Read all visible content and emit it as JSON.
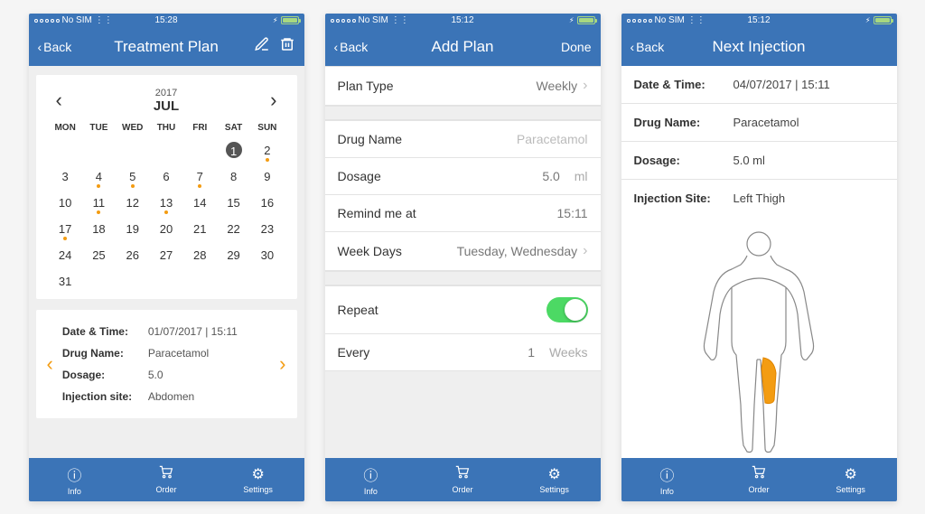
{
  "status_bar": {
    "carrier": "No SIM",
    "wifi_icon": "wifi-icon"
  },
  "tabs": {
    "info": "Info",
    "order": "Order",
    "settings": "Settings"
  },
  "nav": {
    "back": "Back",
    "done": "Done"
  },
  "colors": {
    "primary": "#3b74b7",
    "accent": "#f39c12",
    "toggle_on": "#4cd964"
  },
  "screen1": {
    "status_time": "15:28",
    "title": "Treatment Plan",
    "calendar": {
      "year": "2017",
      "month": "JUL",
      "weekdays": [
        "MON",
        "TUE",
        "WED",
        "THU",
        "FRI",
        "SAT",
        "SUN"
      ],
      "weeks": [
        [
          null,
          null,
          null,
          null,
          null,
          {
            "d": "1",
            "circled": true
          },
          {
            "d": "2",
            "marked": true
          }
        ],
        [
          {
            "d": "3"
          },
          {
            "d": "4",
            "marked": true
          },
          {
            "d": "5",
            "marked": true
          },
          {
            "d": "6"
          },
          {
            "d": "7",
            "marked": true
          },
          {
            "d": "8"
          },
          {
            "d": "9"
          }
        ],
        [
          {
            "d": "10"
          },
          {
            "d": "11",
            "marked": true
          },
          {
            "d": "12"
          },
          {
            "d": "13",
            "marked": true
          },
          {
            "d": "14"
          },
          {
            "d": "15"
          },
          {
            "d": "16"
          }
        ],
        [
          {
            "d": "17",
            "marked": true
          },
          {
            "d": "18"
          },
          {
            "d": "19"
          },
          {
            "d": "20"
          },
          {
            "d": "21"
          },
          {
            "d": "22"
          },
          {
            "d": "23"
          }
        ],
        [
          {
            "d": "24"
          },
          {
            "d": "25"
          },
          {
            "d": "26"
          },
          {
            "d": "27"
          },
          {
            "d": "28"
          },
          {
            "d": "29"
          },
          {
            "d": "30"
          }
        ],
        [
          {
            "d": "31"
          },
          null,
          null,
          null,
          null,
          null,
          null
        ]
      ]
    },
    "details": {
      "date_time_label": "Date & Time:",
      "date_time_value": "01/07/2017 | 15:11",
      "drug_label": "Drug Name:",
      "drug_value": "Paracetamol",
      "dosage_label": "Dosage:",
      "dosage_value": "5.0",
      "site_label": "Injection site:",
      "site_value": "Abdomen"
    }
  },
  "screen2": {
    "status_time": "15:12",
    "title": "Add Plan",
    "rows": {
      "plan_type_label": "Plan Type",
      "plan_type_value": "Weekly",
      "drug_label": "Drug Name",
      "drug_value": "Paracetamol",
      "dosage_label": "Dosage",
      "dosage_value": "5.0",
      "dosage_unit": "ml",
      "remind_label": "Remind me at",
      "remind_value": "15:11",
      "weekdays_label": "Week Days",
      "weekdays_value": "Tuesday, Wednesday",
      "repeat_label": "Repeat",
      "repeat_on": true,
      "every_label": "Every",
      "every_value": "1",
      "every_unit": "Weeks"
    }
  },
  "screen3": {
    "status_time": "15:12",
    "title": "Next Injection",
    "rows": {
      "date_time_label": "Date & Time:",
      "date_time_value": "04/07/2017 | 15:11",
      "drug_label": "Drug Name:",
      "drug_value": "Paracetamol",
      "dosage_label": "Dosage:",
      "dosage_value": "5.0 ml",
      "site_label": "Injection Site:",
      "site_value": "Left Thigh"
    }
  }
}
